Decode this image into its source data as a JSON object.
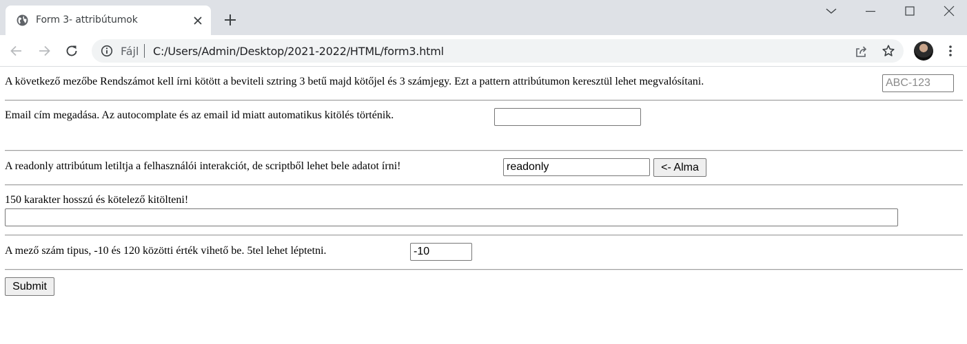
{
  "browser": {
    "tab": {
      "title": "Form 3- attribútumok"
    },
    "address": {
      "scheme_label": "Fájl",
      "url": "C:/Users/Admin/Desktop/2021-2022/HTML/form3.html"
    },
    "icons": [
      "globe-icon",
      "close-icon",
      "plus-icon",
      "chevron-down-icon",
      "minimize-icon",
      "maximize-icon",
      "window-close-icon",
      "back-icon",
      "forward-icon",
      "reload-icon",
      "info-icon",
      "share-icon",
      "star-icon",
      "kebab-menu-icon"
    ]
  },
  "form": {
    "plate": {
      "label": "A következő mezőbe Rendszámot kell írni kötött a beviteli sztring 3 betű majd kötőjel és 3 számjegy. Ezt a pattern attribútumon keresztül lehet megvalósítani.",
      "placeholder": "ABC-123",
      "value": ""
    },
    "email": {
      "label": "Email cím megadása. Az autocomplate és az email id miatt automatikus kitölés történik.",
      "value": ""
    },
    "readonly": {
      "label": "A readonly attribútum letiltja a felhasználói interakciót, de scriptből lehet bele adatot írni!",
      "value": "readonly",
      "button_label": "<- Alma"
    },
    "required_text": {
      "label": "150 karakter hosszú és kötelező kitölteni!",
      "value": ""
    },
    "number": {
      "label": "A mező szám tipus, -10 és 120 közötti érték vihető be. 5tel lehet léptetni.",
      "value": "-10"
    },
    "submit_label": "Submit"
  }
}
